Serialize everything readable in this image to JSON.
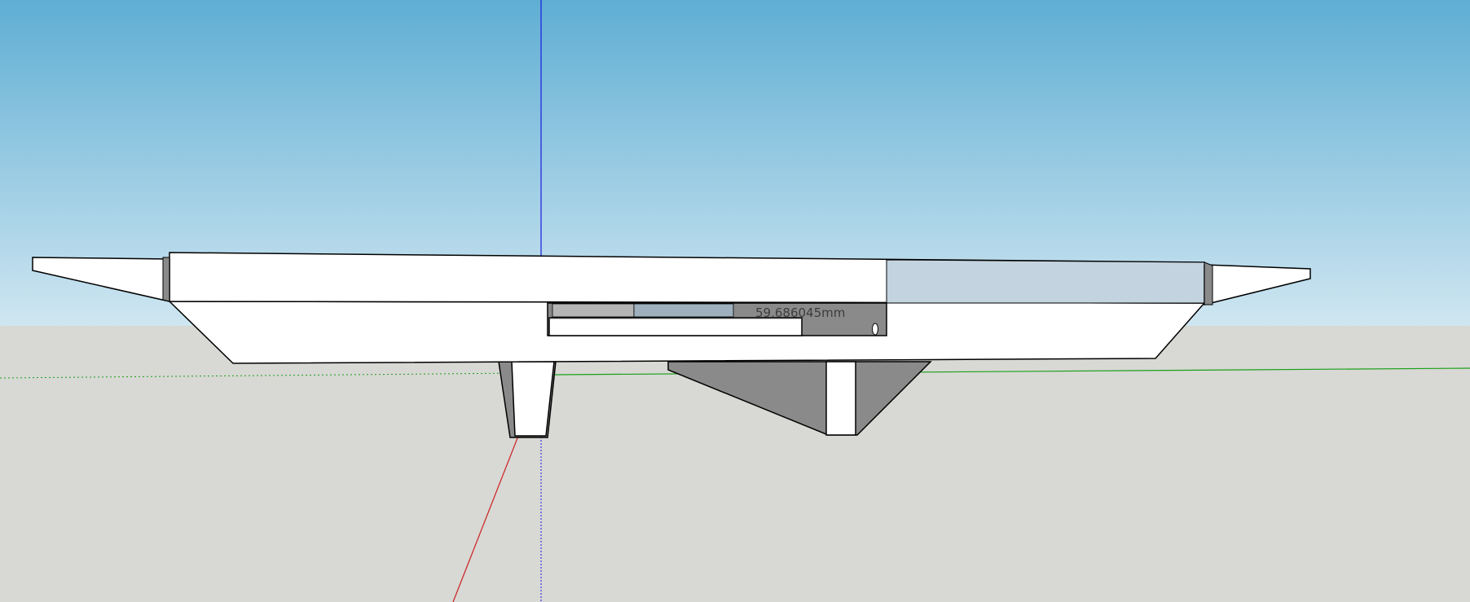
{
  "viewport": {
    "sky_top_color": "#5faed4",
    "sky_bottom_color": "#cfe6f1",
    "ground_color": "#d8d8d4",
    "axis_colors": {
      "red": "#cc1f1f",
      "green": "#19a019",
      "blue": "#1a1ae0"
    }
  },
  "measurement": {
    "label": "59,686045mm"
  },
  "model": {
    "face_color": "#ffffff",
    "shade_color": "#8a8a8a",
    "selected_face_color": "#c3d4e0",
    "edge_color": "#000000"
  }
}
